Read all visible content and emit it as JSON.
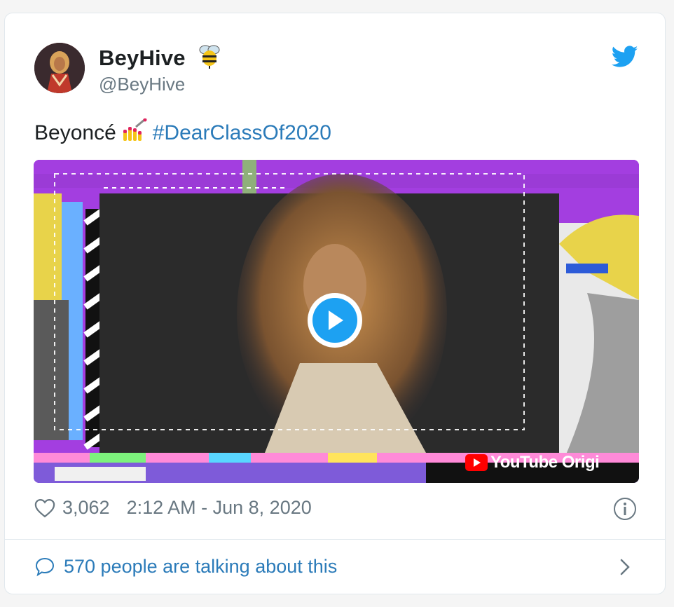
{
  "author": {
    "display_name": "BeyHive",
    "handle": "@BeyHive"
  },
  "tweet": {
    "text_prefix": "Beyoncé",
    "hashtag": "#DearClassOf2020"
  },
  "video": {
    "badge_text": "YouTube Origi"
  },
  "meta": {
    "likes": "3,062",
    "timestamp": "2:12 AM - Jun 8, 2020"
  },
  "footer": {
    "talking": "570 people are talking about this"
  },
  "colors": {
    "link": "#2b7bb9",
    "twitter_blue": "#1da1f2",
    "muted": "#697882",
    "video_purple": "#a33ee0"
  }
}
